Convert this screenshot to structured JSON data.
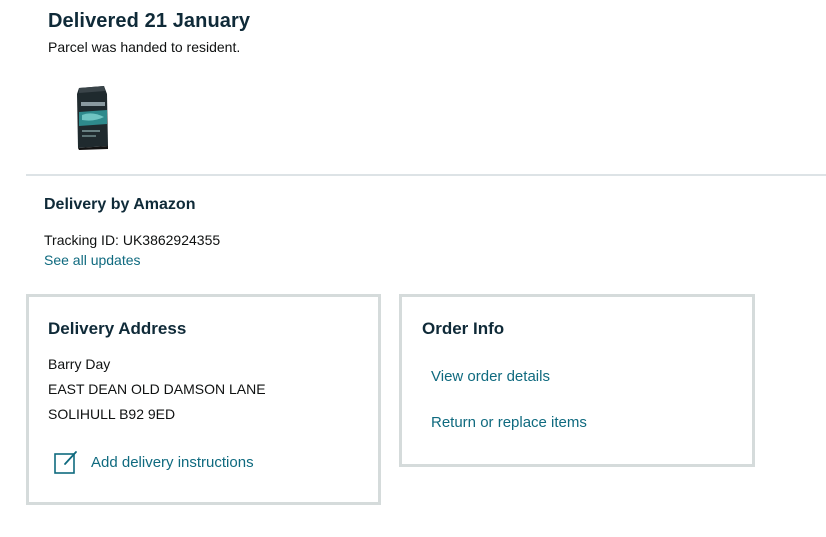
{
  "shipment": {
    "status_title": "Delivered 21 January",
    "status_detail": "Parcel was handed to resident."
  },
  "carrier": {
    "title": "Delivery by Amazon",
    "tracking": "Tracking ID: UK3862924355",
    "see_all_label": "See all updates"
  },
  "address_card": {
    "title": "Delivery Address",
    "lines": [
      "Barry Day",
      "EAST DEAN OLD DAMSON LANE",
      "SOLIHULL B92 9ED"
    ],
    "instructions_label": "Add delivery instructions",
    "instructions_icon": "edit-note-icon"
  },
  "order_card": {
    "title": "Order Info",
    "links": [
      "View order details",
      "Return or replace items"
    ]
  },
  "colors": {
    "link": "#0f6a7f",
    "heading": "#0f2a38",
    "card_border": "#d5dbdb"
  }
}
